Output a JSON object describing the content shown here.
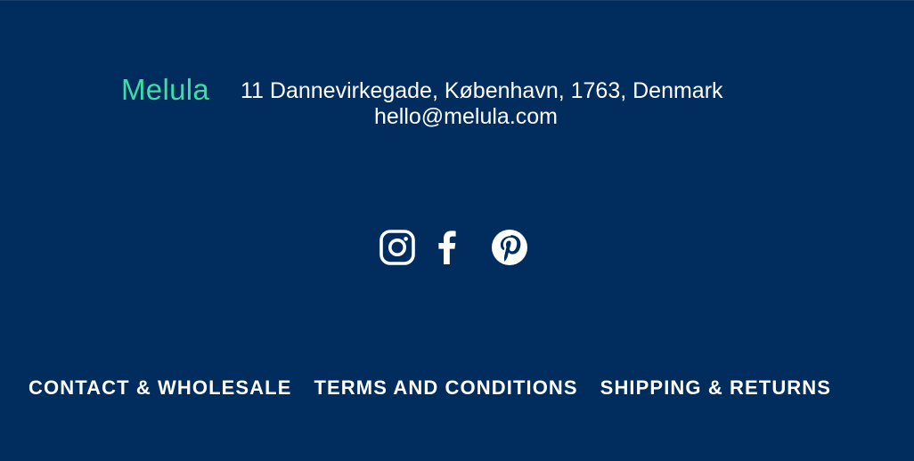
{
  "brand": {
    "name": "Melula",
    "color": "#3ddda6"
  },
  "contact": {
    "address": "11 Dannevirkegade, København, 1763, Denmark",
    "email": "hello@melula.com"
  },
  "social": {
    "icons": [
      "instagram-icon",
      "facebook-icon",
      "pinterest-icon"
    ]
  },
  "footer_links": [
    {
      "label": "CONTACT & WHOLESALE"
    },
    {
      "label": "TERMS AND CONDITIONS"
    },
    {
      "label": "SHIPPING & RETURNS"
    }
  ],
  "colors": {
    "background": "#002d5d",
    "text": "#ffffff"
  }
}
